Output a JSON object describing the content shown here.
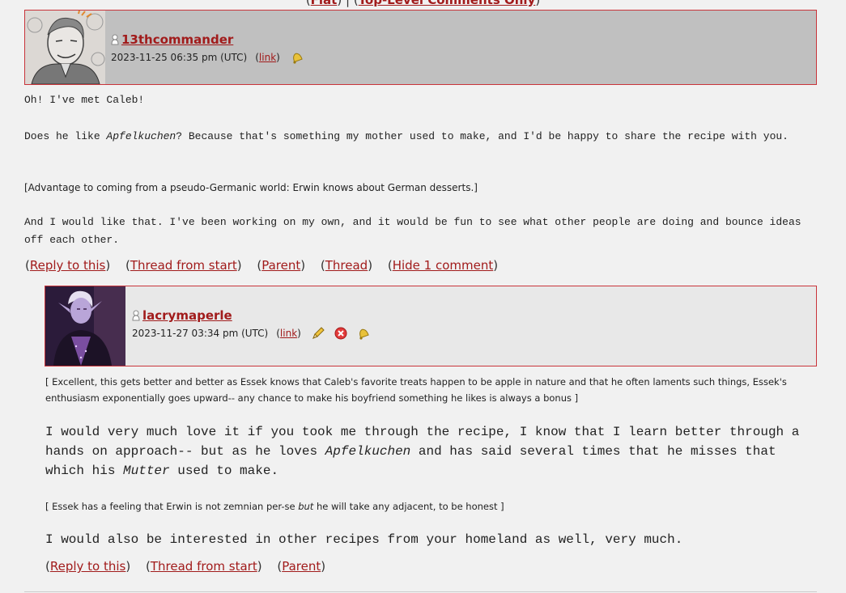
{
  "top_nav": {
    "open1": "(",
    "flat": "Flat",
    "close1": ")",
    "sep": " | ",
    "open2": "(",
    "top_level": "Top-Level Comments Only",
    "close2": ")"
  },
  "comment1": {
    "username": "13thcommander",
    "timestamp": "2023-11-25 06:35 pm (UTC)",
    "link_label": "link",
    "icons": [
      "bell-icon"
    ],
    "body": {
      "line1": "Oh! I've met Caleb!",
      "p2_before": "Does he like ",
      "p2_italic": "Apfelkuchen",
      "p2_after": "? Because that's something my mother used to make, and I'd be happy to share the recipe with you.",
      "note": "[Advantage to coming from a pseudo-Germanic world: Erwin knows about German desserts.]",
      "p3": "And I would like that. I've been working on my own, and it would be fun to see what other people are doing and bounce ideas off each other."
    },
    "actions": {
      "reply": "Reply to this",
      "thread_start": "Thread from start",
      "parent": "Parent",
      "thread": "Thread",
      "hide": "Hide 1 comment"
    }
  },
  "comment2": {
    "username": "lacrymaperle",
    "timestamp": "2023-11-27 03:34 pm (UTC)",
    "link_label": "link",
    "icons": [
      "pencil-icon",
      "delete-icon",
      "bell-icon"
    ],
    "body": {
      "note1": "[ Excellent, this gets better and better as Essek knows that Caleb's favorite treats happen to be apple in nature and that he often laments such things, Essek's enthusiasm exponentially goes upward-- any chance to make his boyfriend something he likes is always a bonus ]",
      "p1_before": "I would very much love it if you took me through the recipe, I know that I learn better through a hands on approach-- but as he loves ",
      "p1_italic1": "Apfelkuchen",
      "p1_mid": " and has said several times that he misses that which his ",
      "p1_italic2": "Mutter",
      "p1_after": " used to make.",
      "note2_before": "[ Essek has a feeling that Erwin is not zemnian per-se ",
      "note2_italic": "but",
      "note2_after": " he will take any adjacent, to be honest ]",
      "p2": "I would also be interested in other recipes from your homeland as well, very much."
    },
    "actions": {
      "reply": "Reply to this",
      "thread_start": "Thread from start",
      "parent": "Parent"
    }
  },
  "colors": {
    "link": "#a11b1b",
    "border": "#c9343a",
    "header1_bg": "#c0c0c0",
    "header2_bg": "#e8e8e8",
    "page_bg": "#f1f1f1"
  }
}
